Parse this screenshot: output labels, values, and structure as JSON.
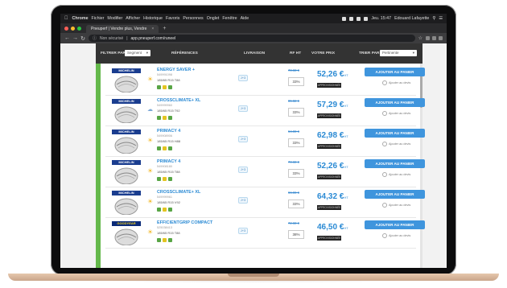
{
  "menubar": {
    "app": "Chrome",
    "items": [
      "Fichier",
      "Modifier",
      "Afficher",
      "Historique",
      "Favoris",
      "Personnes",
      "Onglet",
      "Fenêtre",
      "Aide"
    ],
    "clock": "Jeu. 15:47",
    "user": "Edouard Lafayette"
  },
  "browser": {
    "tab_title": "Pneuperf | Vendre plus, Vendre",
    "url_security": "Non sécurisé",
    "url": "app.pneuperf.com/runeel"
  },
  "filters": {
    "filter_label": "FILTRER PAR",
    "filter_value": "Segment",
    "col_references": "RÉFÉRENCES",
    "col_delivery": "LIVRAISON",
    "col_discount": "RF HT",
    "col_price": "VOTRE PRIX",
    "sort_label": "TRIER PAR",
    "sort_value": "Pertinente"
  },
  "laptop_label": "MacBook Air",
  "colors": {
    "brand_blue": "#2a8ad4",
    "button_blue": "#3f95dd",
    "green_bar": "#64b84b",
    "filter_bg": "#333333"
  },
  "products": [
    {
      "brand": "MICHELIN",
      "name": "ENERGY SAVER +",
      "code": "549991098",
      "size": "185/65 R15 T88",
      "season": "sun",
      "delivery": "J+3",
      "strike": "78.68 €",
      "discount": "33%",
      "price": "52,26 €",
      "price_unit": "HT",
      "tag": "APPROVISIONNÉE",
      "button": "AJOUTER AU PANIER",
      "compare": "Ajouter au devis"
    },
    {
      "brand": "MICHELIN",
      "name": "CROSSCLIMATE+ XL",
      "code": "549999960",
      "size": "185/65 R15 T92",
      "season": "rain",
      "delivery": "J+3",
      "strike": "85.82 €",
      "discount": "33%",
      "price": "57,29 €",
      "price_unit": "HT",
      "tag": "APPROVISIONNÉE",
      "button": "AJOUTER AU PANIER",
      "compare": "Ajouter au devis"
    },
    {
      "brand": "MICHELIN",
      "name": "PRIMACY 4",
      "code": "549908906",
      "size": "185/65 R15 H88",
      "season": "sun",
      "delivery": "J+3",
      "strike": "94.00 €",
      "discount": "33%",
      "price": "62,98 €",
      "price_unit": "HT",
      "tag": "APPROVISIONNÉE",
      "button": "AJOUTER AU PANIER",
      "compare": "Ajouter au devis"
    },
    {
      "brand": "MICHELIN",
      "name": "PRIMACY 4",
      "code": "549908180",
      "size": "185/65 R15 T88",
      "season": "sun",
      "delivery": "J+3",
      "strike": "78.68 €",
      "discount": "33%",
      "price": "52,26 €",
      "price_unit": "HT",
      "tag": "APPROVISIONNÉE",
      "button": "AJOUTER AU PANIER",
      "compare": "Ajouter au devis"
    },
    {
      "brand": "MICHELIN",
      "name": "CROSSCLIMATE+ XL",
      "code": "549999961",
      "size": "185/65 R15 V92",
      "season": "sun",
      "delivery": "J+3",
      "strike": "96.00 €",
      "discount": "33%",
      "price": "64,32 €",
      "price_unit": "HT",
      "tag": "APPROVISIONNÉE",
      "button": "AJOUTER AU PANIER",
      "compare": "Ajouter au devis"
    },
    {
      "brand": "GOODYEAR",
      "name": "EFFICIENTGRIP COMPACT",
      "code": "525038413",
      "size": "185/65 R15 T88",
      "season": "sun",
      "delivery": "J+3",
      "strike": "72.68 €",
      "discount": "38%",
      "price": "46,50 €",
      "price_unit": "HT",
      "tag": "APPROVISIONNÉE",
      "button": "AJOUTER AU PANIER",
      "compare": "Ajouter au devis"
    }
  ]
}
